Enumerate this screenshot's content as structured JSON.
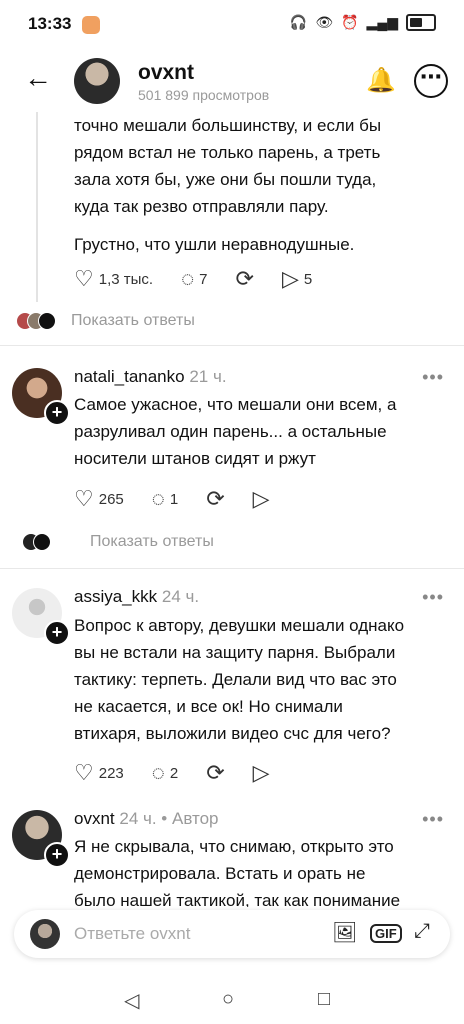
{
  "status": {
    "time": "13:33",
    "icons": [
      "headphones-icon",
      "eye-icon",
      "alarm-icon",
      "signal-icon",
      "battery-icon"
    ]
  },
  "header": {
    "username": "ovxnt",
    "views": "501 899 просмотров"
  },
  "comments": [
    {
      "text_lines": [
        "точно мешали большинству, и если бы",
        "рядом встал не только парень, а треть",
        "зала хотя бы, уже они бы пошли туда,",
        "куда так резво отправляли пару."
      ],
      "text2": "Грустно, что ушли неравнодушные.",
      "likes": "1,3 тыс.",
      "replies": "7",
      "shares": "5",
      "show_replies": "Показать ответы"
    },
    {
      "username": "natali_tananko",
      "time": "21 ч.",
      "text_lines": [
        "Самое ужасное, что мешали они всем, а",
        "разруливал один парень... а остальные",
        "носители штанов сидят и ржут"
      ],
      "likes": "265",
      "replies": "1",
      "show_replies": "Показать ответы"
    },
    {
      "username": "assiya_kkk",
      "time": "24 ч.",
      "text_lines": [
        "Вопрос к автору, девушки мешали однако",
        "вы не встали на защиту парня. Выбрали",
        "тактику: терпеть. Делали вид что вас это",
        "не касается, и все ок! Но снимали",
        "втихаря, выложили видео счс для чего?"
      ],
      "likes": "223",
      "replies": "2"
    },
    {
      "username": "ovxnt",
      "time": "24 ч. • Автор",
      "text_lines": [
        "Я не скрывала, что снимаю, открыто это",
        "демонстрировала. Встать и орать не",
        "было нашей тактикой, так как понимание"
      ]
    }
  ],
  "reply_box": {
    "placeholder": "Ответьте ovxnt"
  },
  "dots": "•••"
}
